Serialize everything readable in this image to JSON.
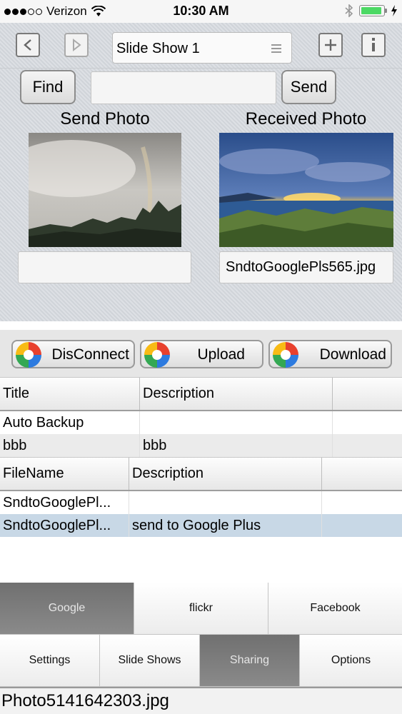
{
  "status": {
    "carrier": "Verizon",
    "time": "10:30 AM",
    "battery_level": 0.95
  },
  "toolbar": {
    "slideshow_title": "Slide Show 1"
  },
  "find": {
    "find_label": "Find",
    "send_label": "Send",
    "search_value": ""
  },
  "photos": {
    "send_heading": "Send Photo",
    "received_heading": "Received Photo",
    "send_filename": "",
    "received_filename": "SndtoGooglePls565.jpg"
  },
  "actions": {
    "disconnect": "DisConnect",
    "upload": "Upload",
    "download": "Download"
  },
  "albums": {
    "columns": [
      "Title",
      "Description"
    ],
    "rows": [
      {
        "title": "Auto Backup",
        "description": ""
      },
      {
        "title": "bbb",
        "description": "bbb"
      }
    ]
  },
  "files": {
    "columns": [
      "FileName",
      "Description"
    ],
    "rows": [
      {
        "filename": "SndtoGooglePl...",
        "description": ""
      },
      {
        "filename": "SndtoGooglePl...",
        "description": "send to Google Plus"
      }
    ]
  },
  "services": {
    "items": [
      "Google",
      "flickr",
      "Facebook"
    ],
    "selected": "Google"
  },
  "tabs": {
    "items": [
      "Settings",
      "Slide Shows",
      "Sharing",
      "Options"
    ],
    "selected": "Sharing"
  },
  "footer": {
    "filename": "Photo5141642303.jpg"
  }
}
